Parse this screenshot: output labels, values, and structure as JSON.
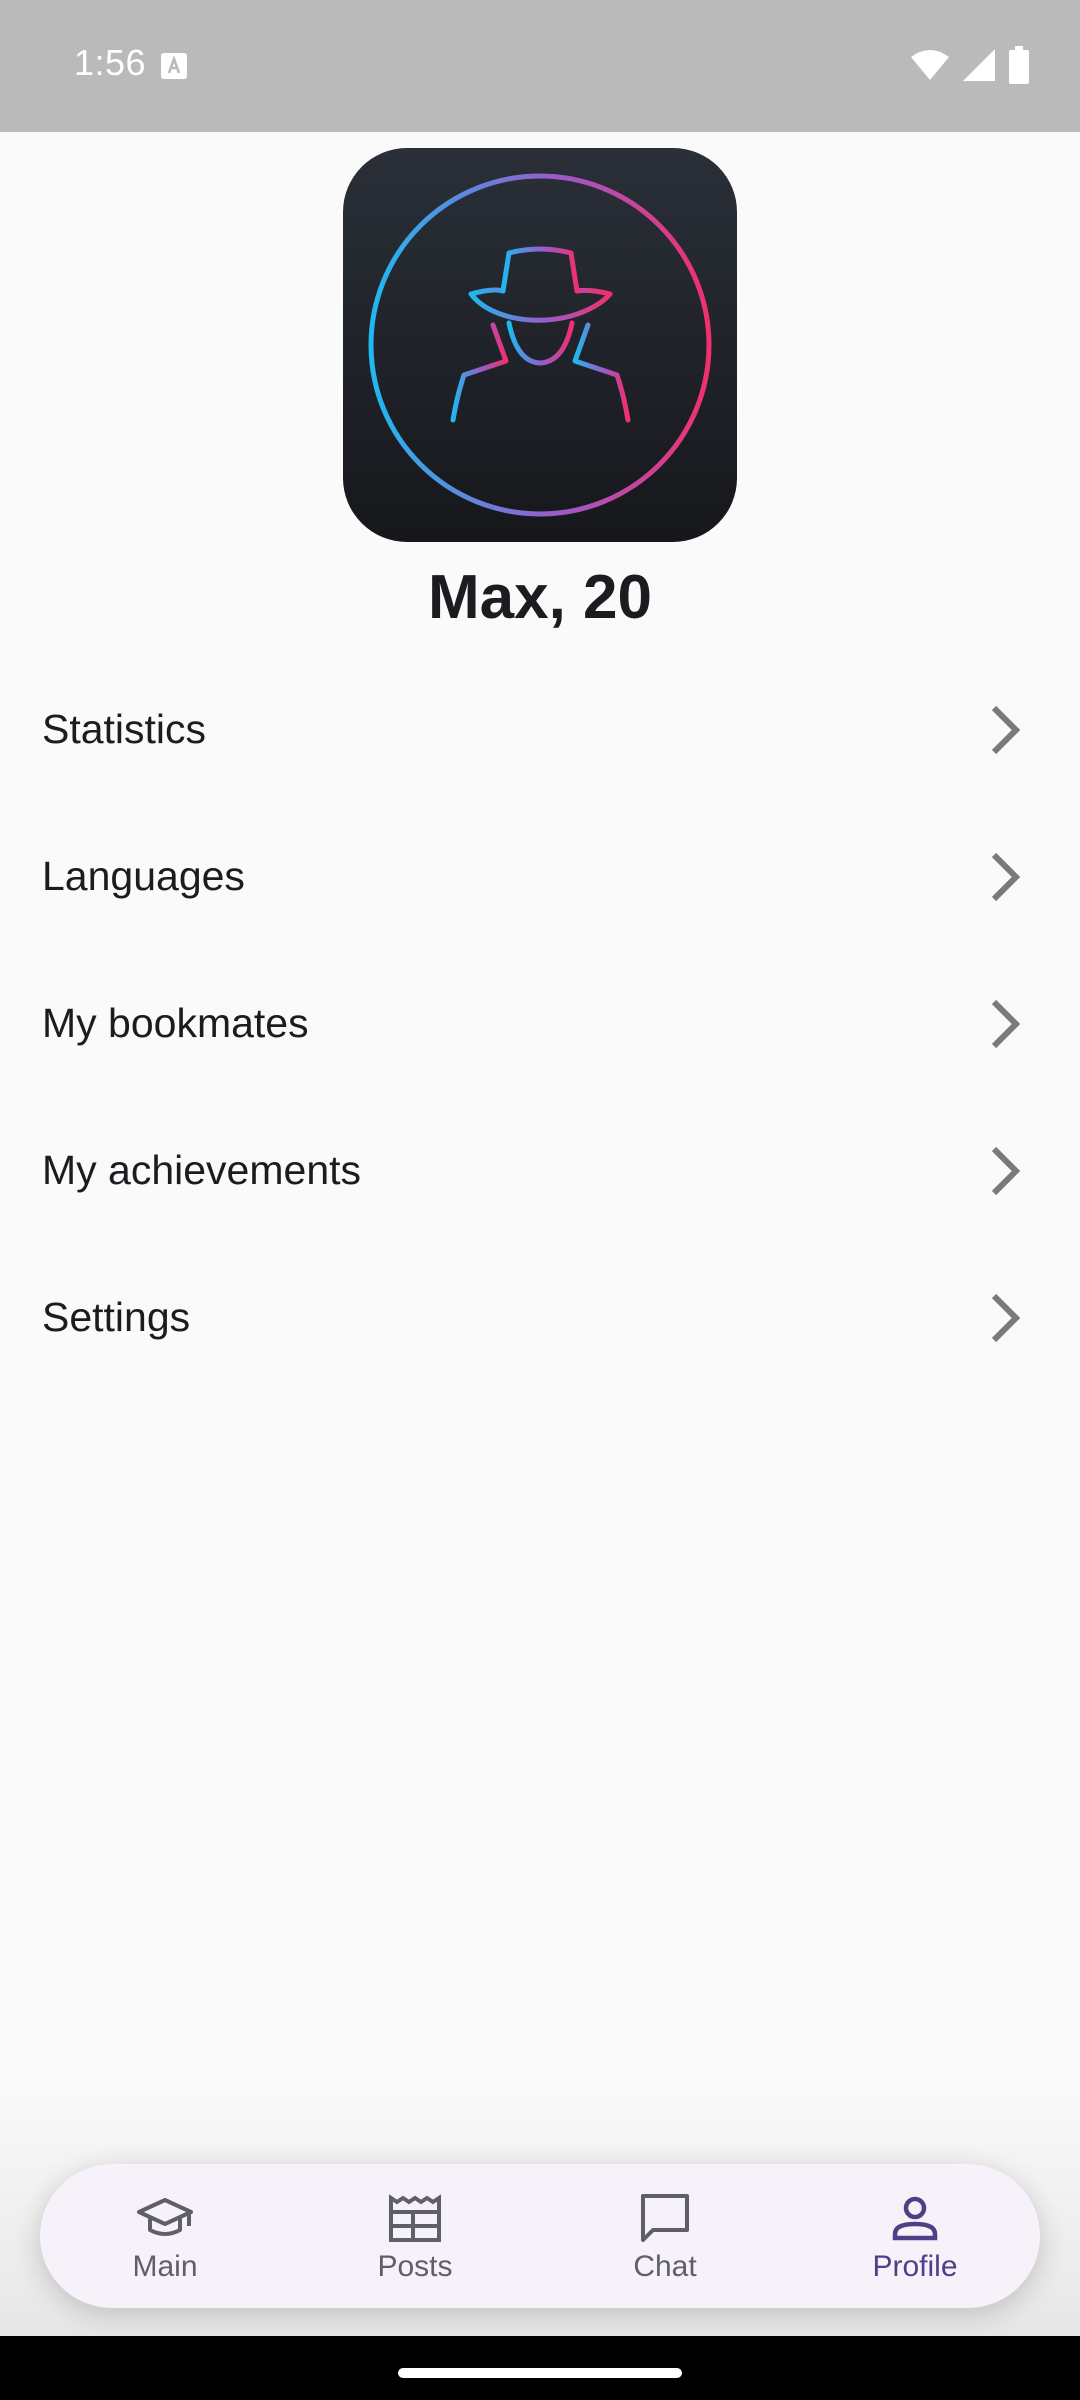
{
  "status_bar": {
    "time": "1:56",
    "icons": [
      "keyboard-a-icon",
      "wifi-icon",
      "signal-icon",
      "battery-icon"
    ]
  },
  "profile": {
    "name": "Max, 20",
    "avatar_icon": "spy-avatar-icon"
  },
  "menu": {
    "items": [
      {
        "label": "Statistics",
        "icon": "chevron-right-icon"
      },
      {
        "label": "Languages",
        "icon": "chevron-right-icon"
      },
      {
        "label": "My bookmates",
        "icon": "chevron-right-icon"
      },
      {
        "label": "My achievements",
        "icon": "chevron-right-icon"
      },
      {
        "label": "Settings",
        "icon": "chevron-right-icon"
      }
    ]
  },
  "bottom_nav": {
    "items": [
      {
        "label": "Main",
        "icon": "graduation-cap-icon",
        "active": false
      },
      {
        "label": "Posts",
        "icon": "newspaper-icon",
        "active": false
      },
      {
        "label": "Chat",
        "icon": "chat-bubble-icon",
        "active": false
      },
      {
        "label": "Profile",
        "icon": "person-icon",
        "active": true
      }
    ]
  },
  "colors": {
    "status_bar": "#bababa",
    "background": "#fafafa",
    "nav_background": "#f7f2fa",
    "nav_active": "#4f3f86",
    "nav_inactive": "#5f5f66",
    "avatar_gradient_start": "#1fb8f0",
    "avatar_gradient_end": "#f0306f"
  }
}
